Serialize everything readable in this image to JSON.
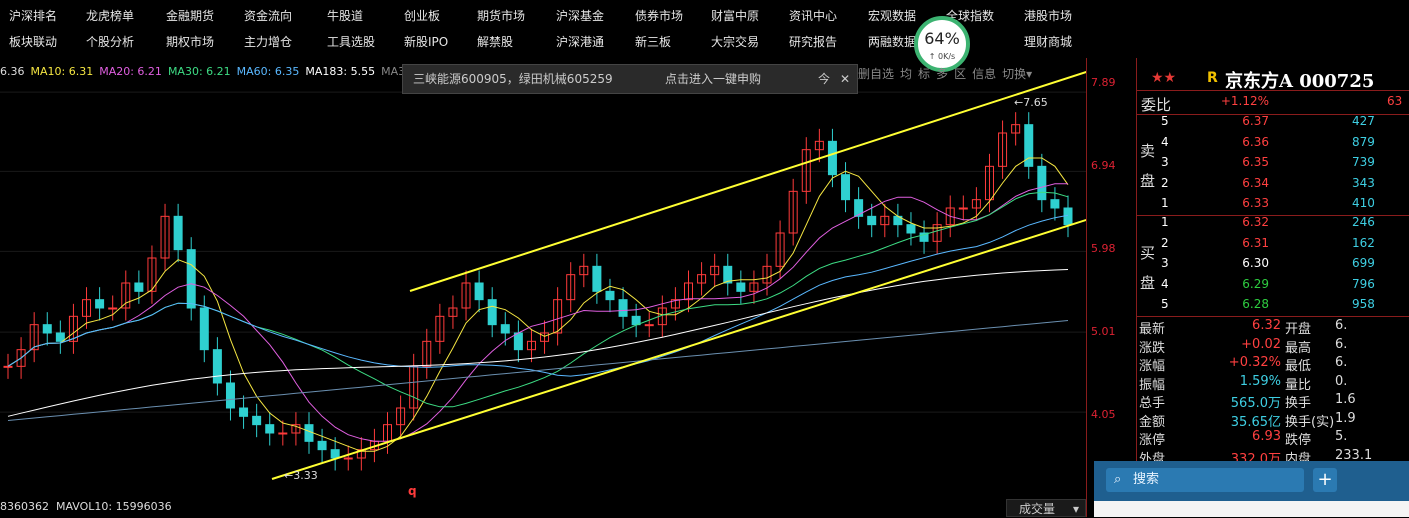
{
  "nav": {
    "row1": [
      "沪深排名",
      "龙虎榜单",
      "金融期货",
      "资金流向",
      "牛股道",
      "创业板",
      "期货市场",
      "沪深基金",
      "债券市场",
      "财富中原",
      "资讯中心",
      "宏观数据",
      "全球指数",
      "港股市场"
    ],
    "row2": [
      "板块联动",
      "个股分析",
      "期权市场",
      "主力增仓",
      "工具选股",
      "新股IPO",
      "解禁股",
      "沪深港通",
      "新三板",
      "大宗交易",
      "研究报告",
      "两融数据",
      "市场",
      "理财商城"
    ]
  },
  "speed_widget": {
    "percent": "64%",
    "rate": "0K/s"
  },
  "ma_legend": [
    {
      "text": "6.36",
      "color": "#dddddd"
    },
    {
      "text": "MA10: 6.31",
      "color": "#f5e642"
    },
    {
      "text": "MA20: 6.21",
      "color": "#e05fe0"
    },
    {
      "text": "MA30: 6.21",
      "color": "#3ddc84"
    },
    {
      "text": "MA60: 6.35",
      "color": "#5ab8ff"
    },
    {
      "text": "MA183: 5.55",
      "color": "#ffffff"
    },
    {
      "text": "MA365: 4.80",
      "color": "#888888"
    }
  ],
  "notice": {
    "text": "三峡能源600905，绿田机械605259",
    "link": "点击进入一键申购",
    "extra": "今",
    "close": "✕"
  },
  "top_controls": [
    "删自选",
    "均",
    "标",
    "多",
    "区",
    "信息",
    "切换▾"
  ],
  "volume": {
    "left": "8360362",
    "mavol": "MAVOL10: 15996036",
    "selector": "成交量"
  },
  "price_axis": [
    "7.89",
    "6.94",
    "5.98",
    "5.01",
    "4.05"
  ],
  "chart_data": {
    "type": "candlestick",
    "high_label": "7.65",
    "low_label": "3.33",
    "marker": "q",
    "ylim": [
      3.2,
      8.0
    ],
    "closes": [
      4.6,
      4.8,
      5.1,
      5.0,
      4.9,
      5.2,
      5.4,
      5.3,
      5.3,
      5.6,
      5.5,
      5.9,
      6.4,
      6.0,
      5.3,
      4.8,
      4.4,
      4.1,
      4.0,
      3.9,
      3.8,
      3.8,
      3.9,
      3.7,
      3.6,
      3.5,
      3.5,
      3.6,
      3.7,
      3.9,
      4.1,
      4.6,
      4.9,
      5.2,
      5.3,
      5.6,
      5.4,
      5.1,
      5.0,
      4.8,
      4.9,
      5.0,
      5.4,
      5.7,
      5.8,
      5.5,
      5.4,
      5.2,
      5.1,
      5.1,
      5.3,
      5.4,
      5.6,
      5.7,
      5.8,
      5.6,
      5.5,
      5.6,
      5.8,
      6.2,
      6.7,
      7.2,
      7.3,
      6.9,
      6.6,
      6.4,
      6.3,
      6.4,
      6.3,
      6.2,
      6.1,
      6.3,
      6.5,
      6.5,
      6.6,
      7.0,
      7.4,
      7.5,
      7.0,
      6.6,
      6.5,
      6.3
    ]
  },
  "quote": {
    "stars": "★★",
    "badge": "R",
    "name": "京东方A 000725",
    "weibi_label": "委比",
    "weibi_value": "+1.12%",
    "weibi_extra": "63",
    "sell_side": "卖盘",
    "buy_side": "买盘",
    "asks": [
      {
        "level": "5",
        "price": "6.37",
        "vol": "427"
      },
      {
        "level": "4",
        "price": "6.36",
        "vol": "879"
      },
      {
        "level": "3",
        "price": "6.35",
        "vol": "739"
      },
      {
        "level": "2",
        "price": "6.34",
        "vol": "343"
      },
      {
        "level": "1",
        "price": "6.33",
        "vol": "410"
      }
    ],
    "bids": [
      {
        "level": "1",
        "price": "6.32",
        "vol": "246"
      },
      {
        "level": "2",
        "price": "6.31",
        "vol": "162"
      },
      {
        "level": "3",
        "price": "6.30",
        "vol": "699"
      },
      {
        "level": "4",
        "price": "6.29",
        "vol": "796"
      },
      {
        "level": "5",
        "price": "6.28",
        "vol": "958"
      }
    ],
    "stats": [
      {
        "k1": "最新",
        "v1": "6.32",
        "c1": "#ff4040",
        "k2": "开盘",
        "v2": "6."
      },
      {
        "k1": "涨跌",
        "v1": "+0.02",
        "c1": "#ff4040",
        "k2": "最高",
        "v2": "6."
      },
      {
        "k1": "涨幅",
        "v1": "+0.32%",
        "c1": "#ff4040",
        "k2": "最低",
        "v2": "6."
      },
      {
        "k1": "振幅",
        "v1": "1.59%",
        "c1": "#3ecfe3",
        "k2": "量比",
        "v2": "0."
      },
      {
        "k1": "总手",
        "v1": "565.0万",
        "c1": "#3ecfe3",
        "k2": "换手",
        "v2": "1.6"
      },
      {
        "k1": "金额",
        "v1": "35.65亿",
        "c1": "#3ecfe3",
        "k2": "换手(实)",
        "v2": "1.9"
      },
      {
        "k1": "涨停",
        "v1": "6.93",
        "c1": "#ff4040",
        "k2": "跌停",
        "v2": "5."
      },
      {
        "k1": "外盘",
        "v1": "332.0万",
        "c1": "#ff4040",
        "k2": "内盘",
        "v2": "233.1"
      }
    ]
  },
  "search": {
    "placeholder": "搜索",
    "add": "+"
  }
}
